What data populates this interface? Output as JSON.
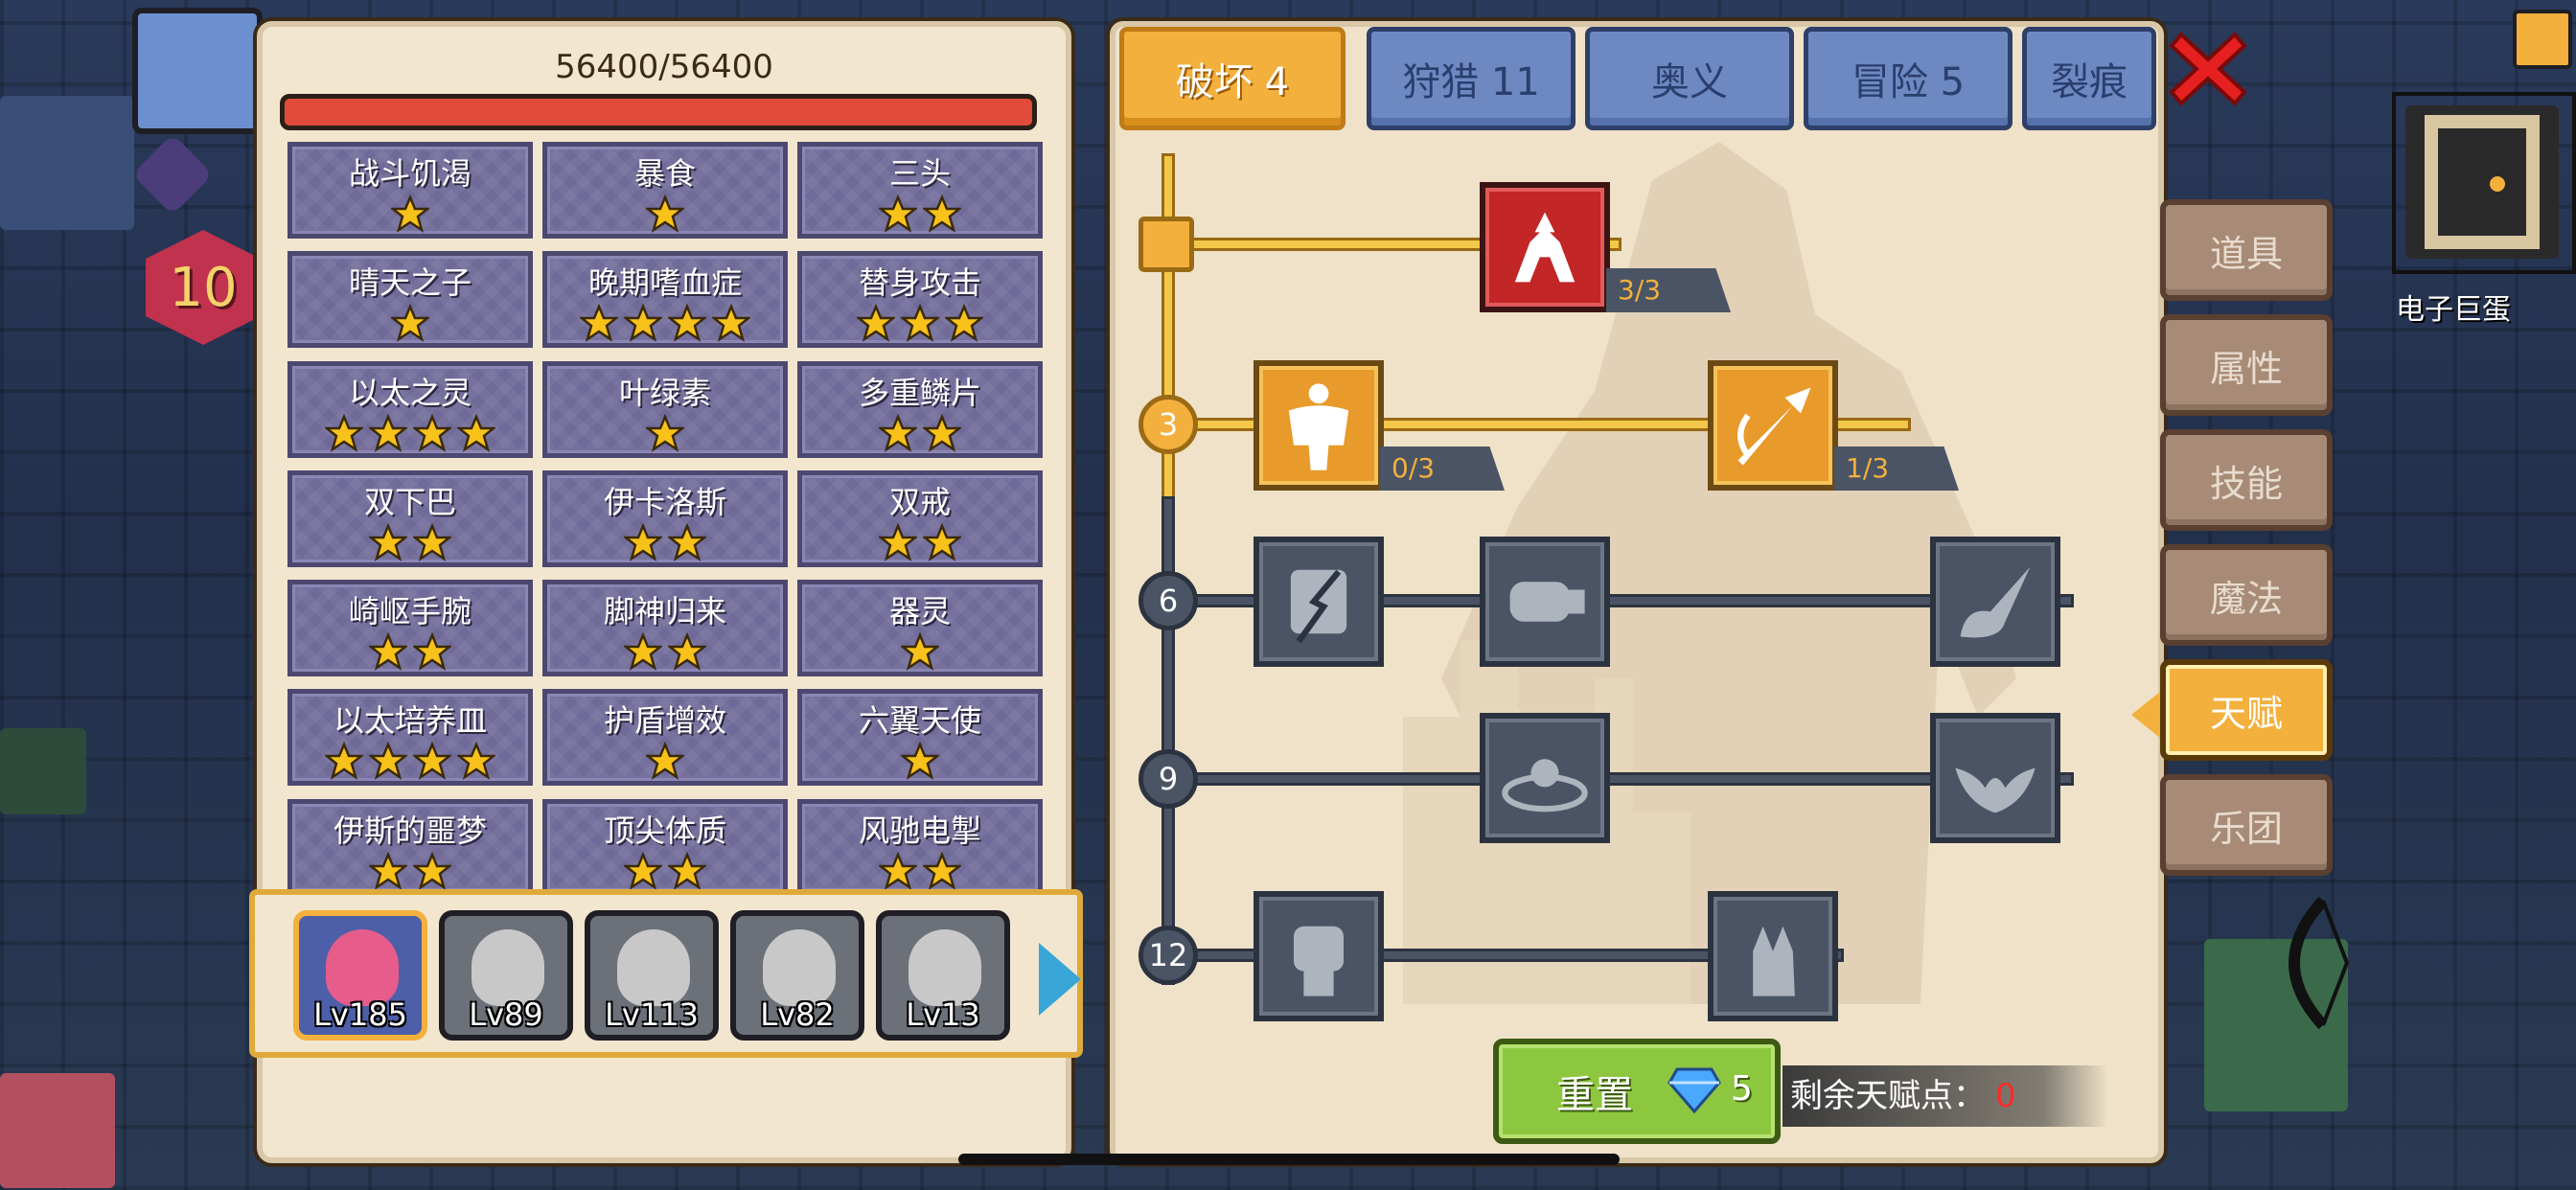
{
  "hp": {
    "text": "56400/56400",
    "current": 56400,
    "max": 56400
  },
  "buffs": [
    {
      "name": "战斗饥渴",
      "stars": 1
    },
    {
      "name": "暴食",
      "stars": 1
    },
    {
      "name": "三头",
      "stars": 2
    },
    {
      "name": "晴天之子",
      "stars": 1
    },
    {
      "name": "晚期嗜血症",
      "stars": 4
    },
    {
      "name": "替身攻击",
      "stars": 3
    },
    {
      "name": "以太之灵",
      "stars": 4
    },
    {
      "name": "叶绿素",
      "stars": 1
    },
    {
      "name": "多重鳞片",
      "stars": 2
    },
    {
      "name": "双下巴",
      "stars": 2
    },
    {
      "name": "伊卡洛斯",
      "stars": 2
    },
    {
      "name": "双戒",
      "stars": 2
    },
    {
      "name": "崎岖手腕",
      "stars": 2
    },
    {
      "name": "脚神归来",
      "stars": 2
    },
    {
      "name": "器灵",
      "stars": 1
    },
    {
      "name": "以太培养皿",
      "stars": 4
    },
    {
      "name": "护盾增效",
      "stars": 1
    },
    {
      "name": "六翼天使",
      "stars": 1
    },
    {
      "name": "伊斯的噩梦",
      "stars": 2
    },
    {
      "name": "顶尖体质",
      "stars": 2
    },
    {
      "name": "风驰电掣",
      "stars": 2
    }
  ],
  "heroes": [
    {
      "level": "Lv185",
      "selected": true
    },
    {
      "level": "Lv89",
      "selected": false
    },
    {
      "level": "Lv113",
      "selected": false
    },
    {
      "level": "Lv82",
      "selected": false
    },
    {
      "level": "Lv13",
      "selected": false
    }
  ],
  "tabs": [
    {
      "label": "破坏 4",
      "active": true
    },
    {
      "label": "狩猎 11",
      "active": false
    },
    {
      "label": "奥义",
      "active": false
    },
    {
      "label": "冒险 5",
      "active": false
    },
    {
      "label": "裂痕",
      "active": false
    }
  ],
  "talent_levels": [
    "3",
    "6",
    "9",
    "12"
  ],
  "talent_nodes": {
    "arm_wrestle": {
      "count": "3/3",
      "icon": "arm-wrestle-icon"
    },
    "muscle": {
      "count": "0/3",
      "icon": "muscle-body-icon"
    },
    "arrow": {
      "count": "1/3",
      "icon": "arrow-icon"
    },
    "row6": [
      "shield-crack-icon",
      "punch-icon",
      "splash-icon"
    ],
    "row9": [
      "ripple-icon",
      "bat-drop-icon"
    ],
    "row12": [
      "fist-icon",
      "open-hand-icon"
    ]
  },
  "reset": {
    "label": "重置",
    "cost": "5"
  },
  "remaining_points": {
    "label": "剩余天赋点：",
    "value": "0"
  },
  "side_nav": [
    {
      "label": "道具",
      "active": false
    },
    {
      "label": "属性",
      "active": false
    },
    {
      "label": "技能",
      "active": false
    },
    {
      "label": "魔法",
      "active": false
    },
    {
      "label": "天赋",
      "active": true
    },
    {
      "label": "乐团",
      "active": false
    }
  ],
  "hud": {
    "level": "10",
    "minimap_label": "电子巨蛋"
  },
  "colors": {
    "accent": "#f3b03c",
    "hp_bar": "#e14b3b",
    "buff_tile": "#6f6a98",
    "reset_green": "#8dc63f",
    "points_red": "#ff2a2a"
  }
}
